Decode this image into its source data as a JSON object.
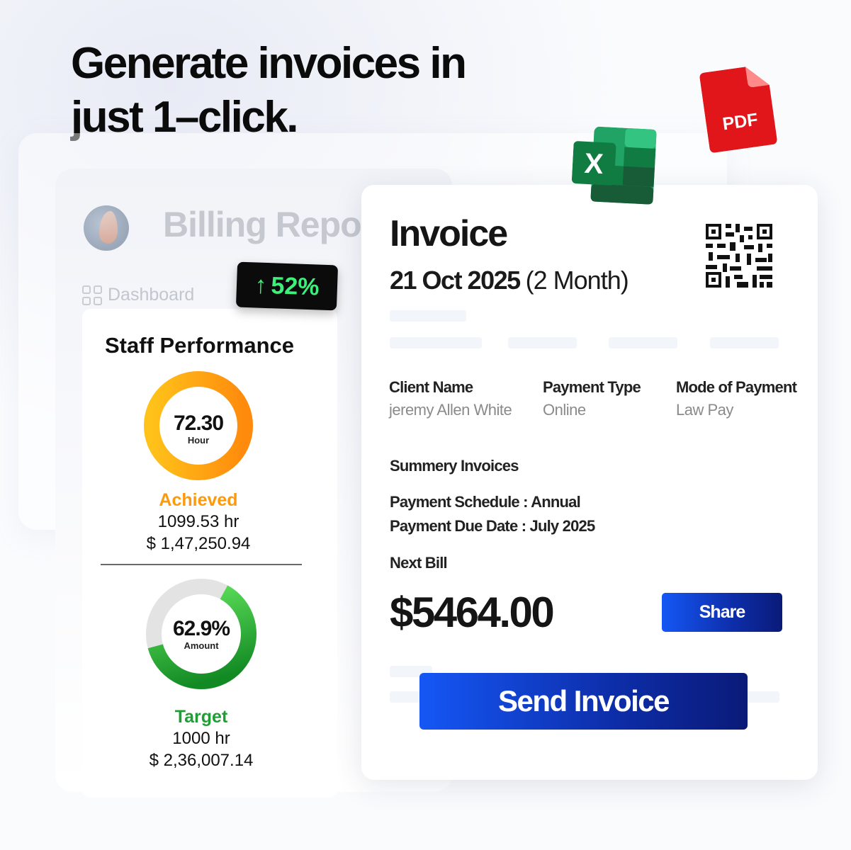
{
  "headline": {
    "line1": "Generate invoices in",
    "line2": "just 1–click."
  },
  "billing": {
    "title": "Billing Repo",
    "nav_dashboard": "Dashboard"
  },
  "badge": {
    "arrow": "↑",
    "value": "52%"
  },
  "staff": {
    "title": "Staff Performance",
    "achieved": {
      "value": "72.30",
      "unit": "Hour",
      "label": "Achieved",
      "hours": "1099.53 hr",
      "amount": "$ 1,47,250.94",
      "progress": 1.0,
      "color": "#fb9a0e"
    },
    "target": {
      "value": "62.9%",
      "unit": "Amount",
      "label": "Target",
      "hours": "1000 hr",
      "amount": "$ 2,36,007.14",
      "progress": 0.629,
      "color": "#1e9e34"
    }
  },
  "invoice": {
    "title": "Invoice",
    "date": "21 Oct 2025",
    "duration": "(2 Month)",
    "client_label": "Client Name",
    "client_value": "jeremy Allen White",
    "payment_type_label": "Payment Type",
    "payment_type_value": "Online",
    "mode_label": "Mode of Payment",
    "mode_value": "Law Pay",
    "summary_label": "Summery Invoices",
    "schedule": "Payment Schedule : Annual",
    "due_date": "Payment Due Date : July 2025",
    "next_bill_label": "Next Bill",
    "amount": "$5464.00",
    "share_label": "Share",
    "send_label": "Send Invoice"
  },
  "icons": {
    "excel_letter": "X",
    "pdf_label": "PDF"
  },
  "colors": {
    "achieved": "#fb9a0e",
    "target": "#1e9e34",
    "badge_text": "#3cf07a",
    "button_start": "#1557f5",
    "button_end": "#0a1a78"
  }
}
